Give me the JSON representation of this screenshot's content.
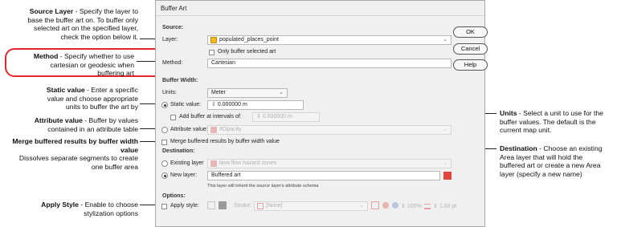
{
  "annotations": {
    "source_layer": {
      "title": "Source Layer",
      "text": [
        " - Specify the layer to",
        "base the buffer art on. To buffer only",
        "selected art on the specified layer,",
        "check the option below it."
      ]
    },
    "method": {
      "title": "Method",
      "text": [
        " - Specify whether to use",
        "cartesian or geodesic  when",
        "buffering art"
      ]
    },
    "static_value": {
      "title": "Static value",
      "text": [
        " - Enter a specific",
        "value and choose appropriate",
        "units to buffer the art by"
      ]
    },
    "attribute_value": {
      "title": "Attribute value",
      "text": [
        " - Buffer by values",
        "contained in an attribute table"
      ]
    },
    "merge": {
      "title": "Merge buffered results by buffer width value",
      "text": [
        "Dissolves separate segments to create",
        "one buffer area"
      ]
    },
    "apply_style": {
      "title": "Apply Style",
      "text": [
        " - Enable to choose",
        "stylization options"
      ]
    },
    "units": {
      "title": "Units",
      "text": [
        " - Select a unit to use for the",
        "buffer values. The default is the",
        "current map unit."
      ]
    },
    "destination": {
      "title": "Destination",
      "text": [
        " - Choose an existing",
        "Area layer that will hold the",
        "buffered art or create a new Area",
        "layer (specify a new name)"
      ]
    }
  },
  "dialog": {
    "title": "Buffer Art",
    "source_section": "Source:",
    "layer_label": "Layer:",
    "layer_value": "populated_places_point",
    "only_selected_label": "Only buffer selected art",
    "method_label": "Method:",
    "method_value": "Cartesian",
    "buffer_width_section": "Buffer Width:",
    "units_label": "Units:",
    "units_value": "Meter",
    "static_label": "Static value:",
    "static_value": "0.000000 m",
    "intervals_label": "Add buffer at intervals of:",
    "intervals_value": "0.000000 m",
    "attribute_label": "Attribute value:",
    "attribute_value": "#Opacity",
    "merge_label": "Merge buffered results by buffer width value",
    "destination_section": "Destination:",
    "existing_label": "Existing layer",
    "existing_value": "lava flow hazard zones",
    "new_layer_label": "New layer:",
    "new_layer_value": "Buffered art",
    "inherit_note": "This layer will inherit the source layer's attribute schema",
    "options_section": "Options:",
    "apply_style_label": "Apply style:",
    "stroke_label": "Stroke:",
    "stroke_value": "[None]",
    "opacity_value": "100%",
    "stroke_width_value": "1.00 pt",
    "buttons": {
      "ok": "OK",
      "cancel": "Cancel",
      "help": "Help"
    }
  },
  "colors": {
    "highlight": "#e3262c",
    "layer_icon": "#f4b72a",
    "new_layer_icon": "#e0463b"
  }
}
